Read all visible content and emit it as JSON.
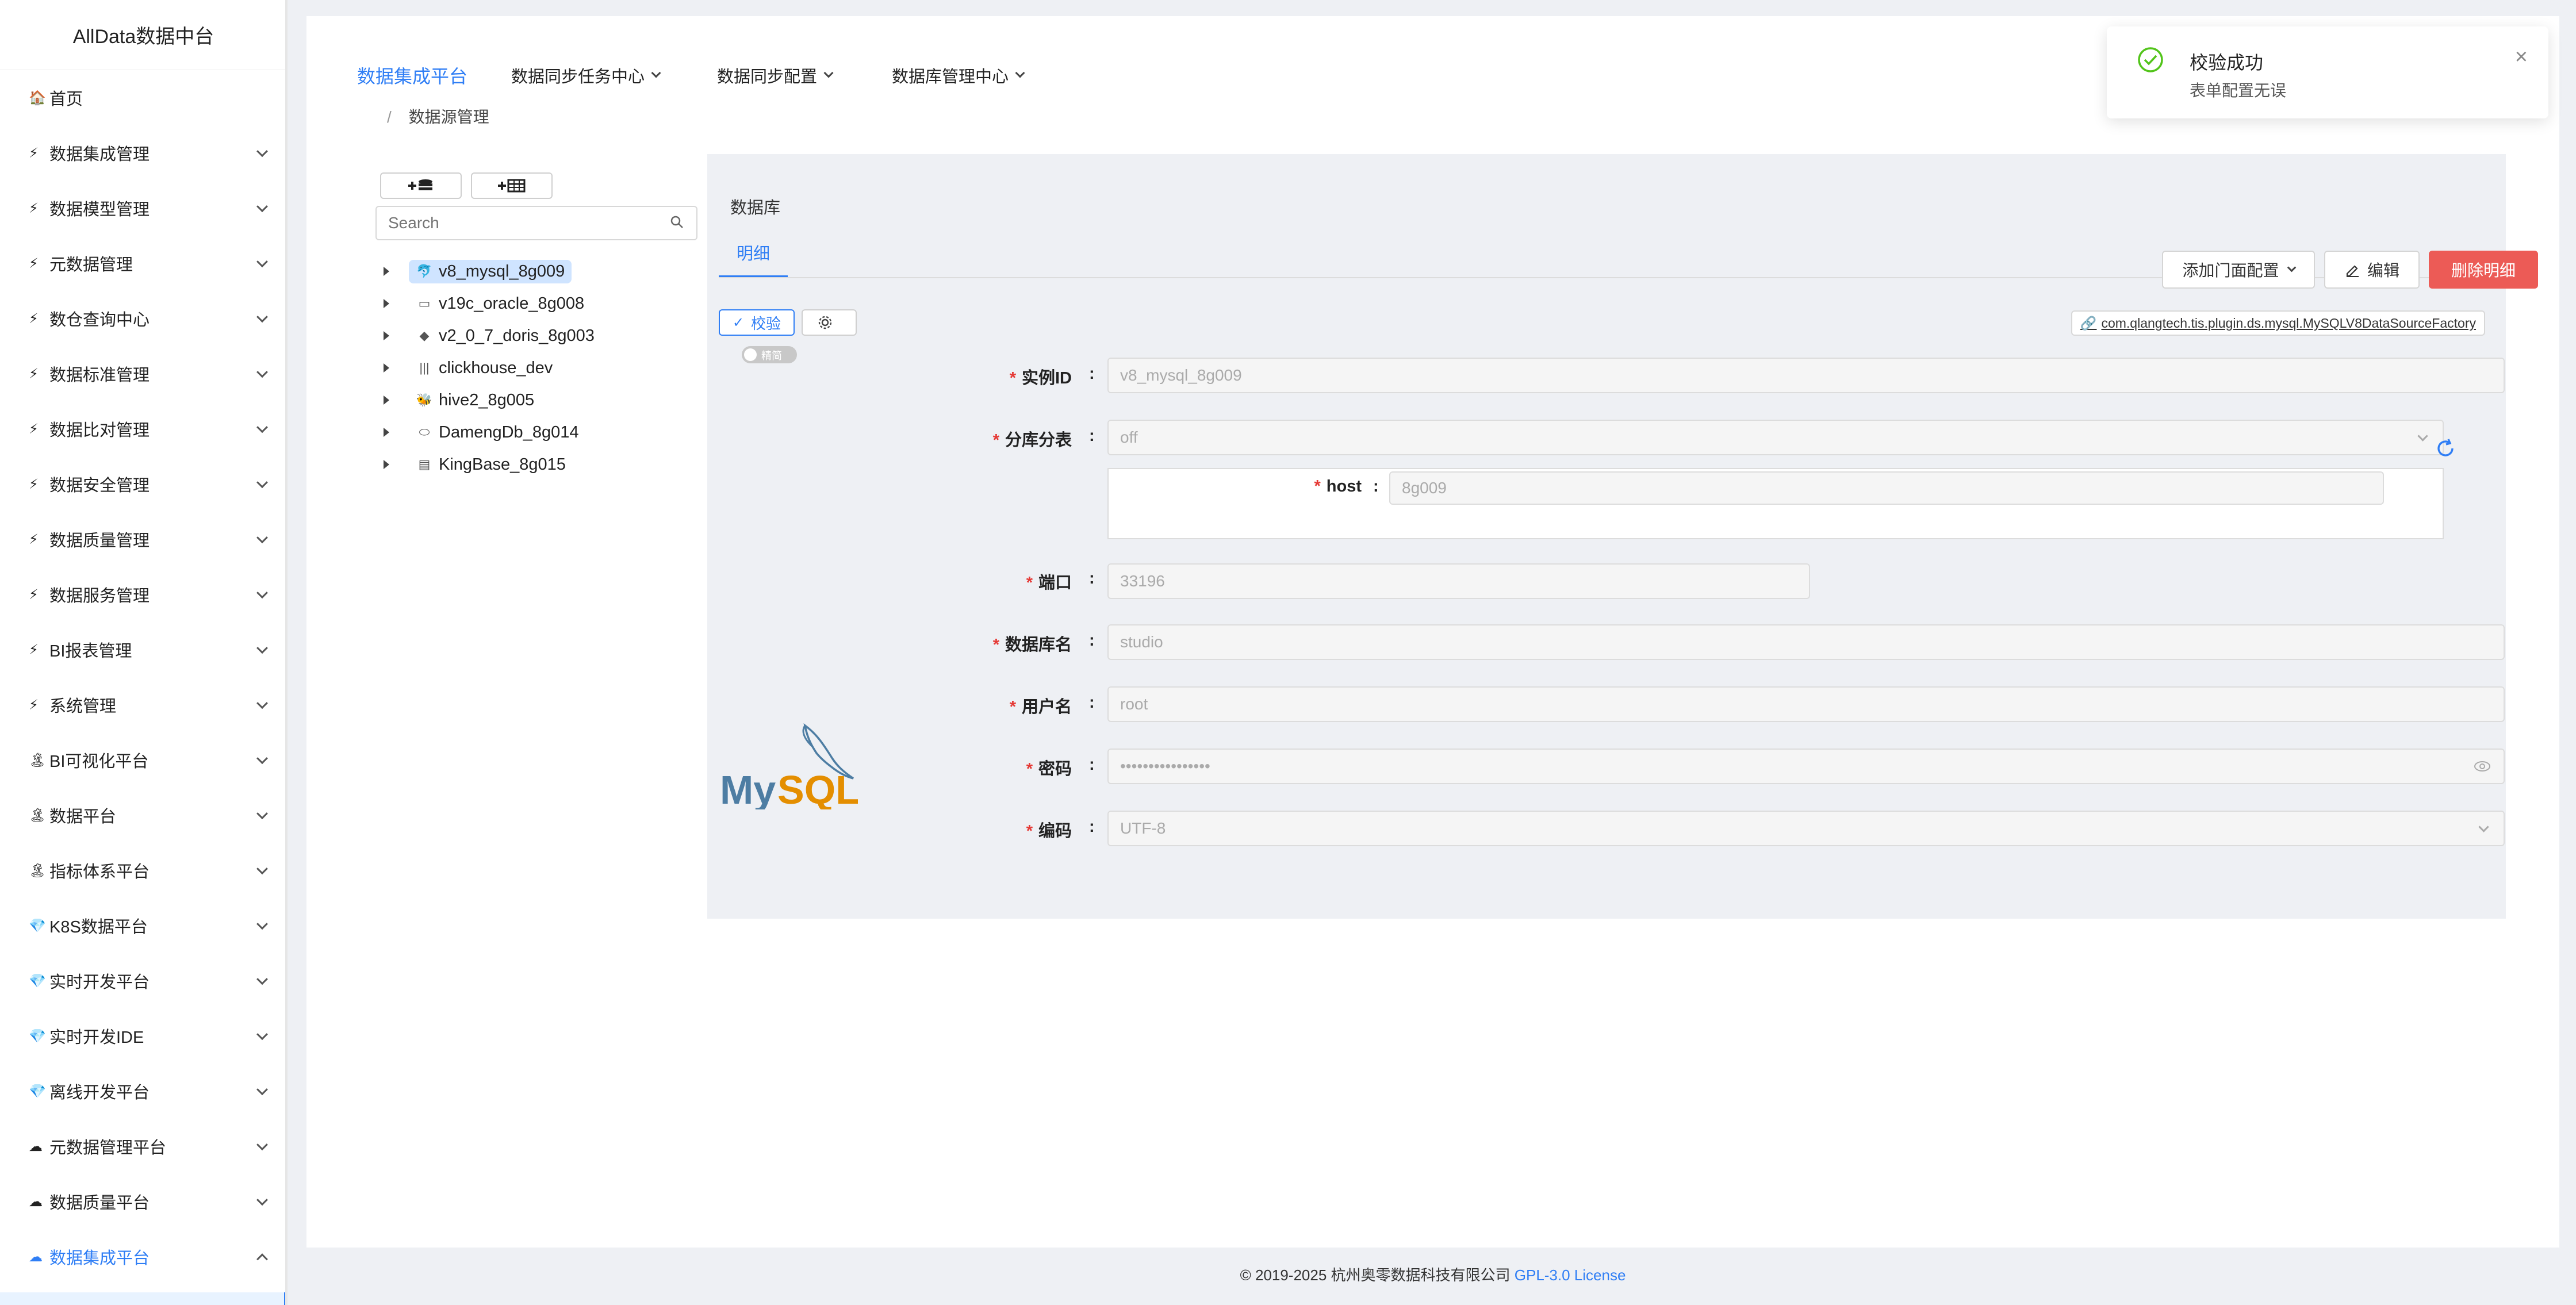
{
  "sidebar": {
    "brand": "AllData数据中台",
    "items": [
      {
        "icon": "house-icon",
        "glyph": "🏠",
        "label": "首页",
        "expandable": false
      },
      {
        "icon": "lightning-icon",
        "glyph": "⚡",
        "label": "数据集成管理",
        "expandable": true
      },
      {
        "icon": "lightning-icon",
        "glyph": "⚡",
        "label": "数据模型管理",
        "expandable": true
      },
      {
        "icon": "lightning-icon",
        "glyph": "⚡",
        "label": "元数据管理",
        "expandable": true
      },
      {
        "icon": "lightning-icon",
        "glyph": "⚡",
        "label": "数仓查询中心",
        "expandable": true
      },
      {
        "icon": "lightning-icon",
        "glyph": "⚡",
        "label": "数据标准管理",
        "expandable": true
      },
      {
        "icon": "lightning-icon",
        "glyph": "⚡",
        "label": "数据比对管理",
        "expandable": true
      },
      {
        "icon": "lightning-icon",
        "glyph": "⚡",
        "label": "数据安全管理",
        "expandable": true
      },
      {
        "icon": "lightning-icon",
        "glyph": "⚡",
        "label": "数据质量管理",
        "expandable": true
      },
      {
        "icon": "lightning-icon",
        "glyph": "⚡",
        "label": "数据服务管理",
        "expandable": true
      },
      {
        "icon": "lightning-icon",
        "glyph": "⚡",
        "label": "BI报表管理",
        "expandable": true
      },
      {
        "icon": "lightning-icon",
        "glyph": "⚡",
        "label": "系统管理",
        "expandable": true
      },
      {
        "icon": "palm-tree-icon",
        "glyph": "🏝",
        "label": "BI可视化平台",
        "expandable": true
      },
      {
        "icon": "palm-tree-icon",
        "glyph": "🏝",
        "label": "数据平台",
        "expandable": true
      },
      {
        "icon": "palm-tree-icon",
        "glyph": "🏝",
        "label": "指标体系平台",
        "expandable": true
      },
      {
        "icon": "gem-icon",
        "glyph": "💎",
        "label": "K8S数据平台",
        "expandable": true
      },
      {
        "icon": "gem-icon",
        "glyph": "💎",
        "label": "实时开发平台",
        "expandable": true
      },
      {
        "icon": "gem-icon",
        "glyph": "💎",
        "label": "实时开发IDE",
        "expandable": true
      },
      {
        "icon": "gem-icon",
        "glyph": "💎",
        "label": "离线开发平台",
        "expandable": true
      },
      {
        "icon": "cloud-icon",
        "glyph": "☁",
        "label": "元数据管理平台",
        "expandable": true
      },
      {
        "icon": "cloud-icon",
        "glyph": "☁",
        "label": "数据质量平台",
        "expandable": true
      },
      {
        "icon": "cloud-icon",
        "glyph": "☁",
        "label": "数据集成平台",
        "expandable": true,
        "active": true
      }
    ]
  },
  "topnav": {
    "items": [
      {
        "label": "数据集成平台",
        "active": true
      },
      {
        "label": "数据同步任务中心",
        "dropdown": true
      },
      {
        "label": "数据同步配置",
        "dropdown": true
      },
      {
        "label": "数据库管理中心",
        "dropdown": true
      }
    ]
  },
  "breadcrumb": {
    "separator": "/",
    "current": "数据源管理"
  },
  "tree": {
    "add_db_label": "+≡",
    "add_table_label": "+▦",
    "search_placeholder": "Search",
    "nodes": [
      {
        "label": "v8_mysql_8g009",
        "icon": "mysql-icon",
        "glyph": "🐬",
        "selected": true
      },
      {
        "label": "v19c_oracle_8g008",
        "icon": "oracle-icon",
        "glyph": "▭"
      },
      {
        "label": "v2_0_7_doris_8g003",
        "icon": "doris-icon",
        "glyph": "◆"
      },
      {
        "label": "clickhouse_dev",
        "icon": "clickhouse-icon",
        "glyph": "|||"
      },
      {
        "label": "hive2_8g005",
        "icon": "hive-icon",
        "glyph": "🐝"
      },
      {
        "label": "DamengDb_8g014",
        "icon": "dameng-icon",
        "glyph": "⬭"
      },
      {
        "label": "KingBase_8g015",
        "icon": "kingbase-icon",
        "glyph": "▤"
      }
    ]
  },
  "detail": {
    "panel_title": "数据库",
    "tab_label": "明细",
    "add_facade_label": "添加门面配置",
    "edit_label": "编辑",
    "delete_label": "删除明细",
    "verify_label": "校验",
    "toggle_label": "精简",
    "plugin_class": "com.qlangtech.tis.plugin.ds.mysql.MySQLV8DataSourceFactory",
    "logo_text": "MySQL",
    "fields": {
      "instance_id": {
        "label": "实例ID",
        "value": "v8_mysql_8g009"
      },
      "sharding": {
        "label": "分库分表",
        "value": "off"
      },
      "host": {
        "label": "host",
        "value": "8g009"
      },
      "port": {
        "label": "端口",
        "value": "33196"
      },
      "dbname": {
        "label": "数据库名",
        "value": "studio"
      },
      "username": {
        "label": "用户名",
        "value": "root"
      },
      "password": {
        "label": "密码",
        "value": "••••••••••••••••"
      },
      "encoding": {
        "label": "编码",
        "value": "UTF-8"
      }
    }
  },
  "footer": {
    "copyright": "© 2019-2025 杭州奥零数据科技有限公司",
    "license": "GPL-3.0 License"
  },
  "notification": {
    "title": "校验成功",
    "message": "表单配置无误",
    "close": "×"
  },
  "colors": {
    "accent": "#2f7ef5",
    "danger": "#ec5b56",
    "success": "#52c41a",
    "required": "#e53935"
  }
}
